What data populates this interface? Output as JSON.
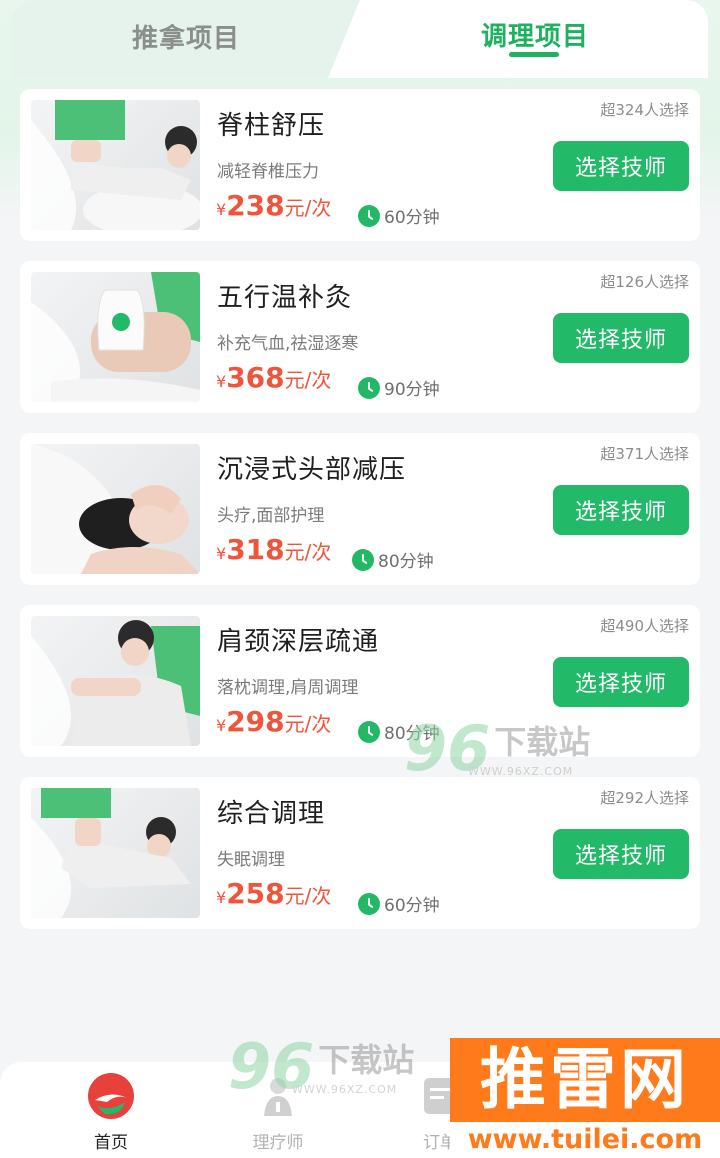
{
  "tabs": [
    {
      "label": "推拿项目",
      "active": false
    },
    {
      "label": "调理项目",
      "active": true
    }
  ],
  "items": [
    {
      "title": "脊柱舒压",
      "desc": "减轻脊椎压力",
      "currency": "¥",
      "price": "238",
      "unit": "元/次",
      "duration": "60分钟",
      "chosen": "超324人选择",
      "button": "选择技师"
    },
    {
      "title": "五行温补灸",
      "desc": "补充气血,祛湿逐寒",
      "currency": "¥",
      "price": "368",
      "unit": "元/次",
      "duration": "90分钟",
      "chosen": "超126人选择",
      "button": "选择技师"
    },
    {
      "title": "沉浸式头部减压",
      "desc": "头疗,面部护理",
      "currency": "¥",
      "price": "318",
      "unit": "元/次",
      "duration": "80分钟",
      "chosen": "超371人选择",
      "button": "选择技师"
    },
    {
      "title": "肩颈深层疏通",
      "desc": "落枕调理,肩周调理",
      "currency": "¥",
      "price": "298",
      "unit": "元/次",
      "duration": "80分钟",
      "chosen": "超490人选择",
      "button": "选择技师"
    },
    {
      "title": "综合调理",
      "desc": "失眠调理",
      "currency": "¥",
      "price": "258",
      "unit": "元/次",
      "duration": "60分钟",
      "chosen": "超292人选择",
      "button": "选择技师"
    }
  ],
  "nav": {
    "home": "首页",
    "therapist": "理疗师",
    "order": "订单"
  },
  "watermarks": {
    "site96_number": "96",
    "site96_text": "下载站",
    "site96_url": "WWW.96XZ.COM",
    "tuilei_text": "推雷网",
    "tuilei_url": "www.tuilei.com"
  },
  "colors": {
    "accent": "#22ba68",
    "price": "#f0553b",
    "tuilei": "#ff7a1a"
  }
}
